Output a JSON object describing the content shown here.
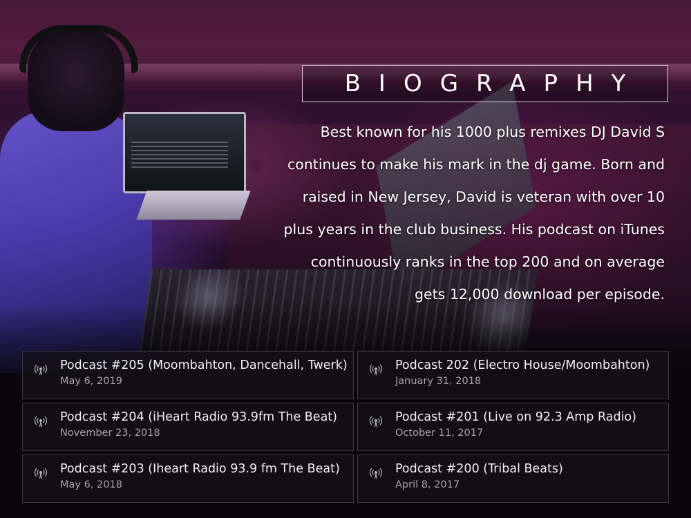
{
  "biography": {
    "title": "BIOGRAPHY",
    "text": "Best known for his 1000 plus remixes DJ David S continues to make his mark in the dj game. Born and raised in New Jersey, David is veteran with over 10 plus years in the club business. His podcast on iTunes continuously ranks in the top 200 and on average gets 12,000 download per episode."
  },
  "podcasts": [
    {
      "title": "Podcast #205 (Moombahton, Dancehall, Twerk)",
      "date": "May 6, 2019",
      "icon": "podcast-icon"
    },
    {
      "title": "Podcast 202 (Electro House/Moombahton)",
      "date": "January 31, 2018",
      "icon": "podcast-icon"
    },
    {
      "title": "Podcast #204 (iHeart Radio 93.9fm The Beat)",
      "date": "November 23, 2018",
      "icon": "podcast-icon"
    },
    {
      "title": "Podcast #201 (Live on 92.3 Amp Radio)",
      "date": "October 11, 2017",
      "icon": "podcast-icon"
    },
    {
      "title": "Podcast #203 (Iheart Radio 93.9 fm The Beat)",
      "date": "May 6, 2018",
      "icon": "podcast-icon"
    },
    {
      "title": "Podcast #200 (Tribal Beats)",
      "date": "April 8, 2017",
      "icon": "podcast-icon"
    }
  ]
}
